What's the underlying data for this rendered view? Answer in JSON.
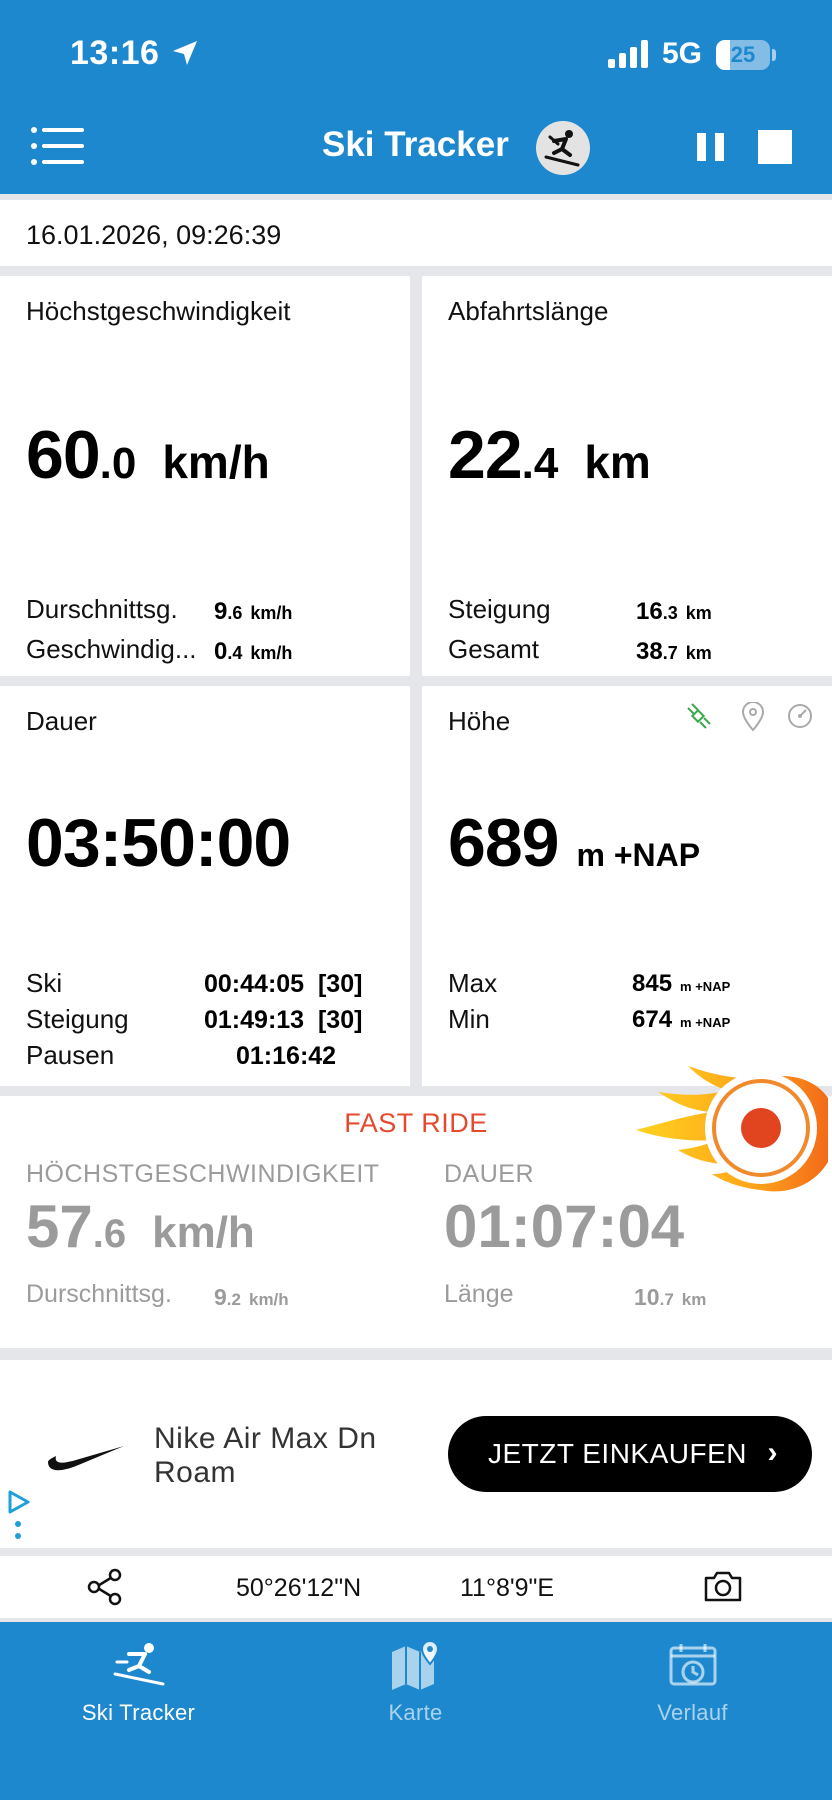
{
  "status": {
    "time": "13:16",
    "network": "5G",
    "battery": "25",
    "battery_level": 0.25
  },
  "header": {
    "title": "Ski Tracker",
    "icons": [
      "menu-icon",
      "skier-icon",
      "pause-icon",
      "stop-icon"
    ]
  },
  "session": {
    "datetime": "16.01.2026, 09:26:39"
  },
  "speed_card": {
    "label": "Höchstgeschwindigkeit",
    "value_int": "60",
    "value_dec": ".0",
    "unit": "km/h",
    "rows": [
      {
        "label": "Durschnittsg.",
        "int": "9",
        "dec": ".6",
        "unit": "km/h"
      },
      {
        "label": "Geschwindig...",
        "int": "0",
        "dec": ".4",
        "unit": "km/h"
      }
    ]
  },
  "distance_card": {
    "label": "Abfahrtslänge",
    "value_int": "22",
    "value_dec": ".4",
    "unit": "km",
    "rows": [
      {
        "label": "Steigung",
        "int": "16",
        "dec": ".3",
        "unit": "km"
      },
      {
        "label": "Gesamt",
        "int": "38",
        "dec": ".7",
        "unit": "km"
      }
    ]
  },
  "duration_card": {
    "label": "Dauer",
    "value": "03:50:00",
    "rows": [
      {
        "label": "Ski",
        "value": "00:44:05",
        "count": "[30]"
      },
      {
        "label": "Steigung",
        "value": "01:49:13",
        "count": "[30]"
      },
      {
        "label": "Pausen",
        "value": "01:16:42"
      }
    ]
  },
  "altitude_card": {
    "label": "Höhe",
    "value": "689",
    "unit": "m +NAP",
    "icons": [
      "satellite-icon",
      "location-pin-icon",
      "gauge-icon"
    ],
    "rows": [
      {
        "label": "Max",
        "value": "845",
        "unit": "m +NAP"
      },
      {
        "label": "Min",
        "value": "674",
        "unit": "m +NAP"
      }
    ]
  },
  "fast_ride": {
    "title": "FAST RIDE",
    "speed_label": "HÖCHSTGESCHWINDIGKEIT",
    "speed_int": "57",
    "speed_dec": ".6",
    "speed_unit": "km/h",
    "avg_label": "Durschnittsg.",
    "avg_int": "9",
    "avg_dec": ".2",
    "avg_unit": "km/h",
    "duration_label": "DAUER",
    "duration_value": "01:07:04",
    "length_label": "Länge",
    "length_int": "10",
    "length_dec": ".7",
    "length_unit": "km",
    "colors": {
      "title": "#e64a2e",
      "record": "#e0451f"
    }
  },
  "ad": {
    "product": "Nike Air Max Dn Roam",
    "cta": "JETZT EINKAUFEN",
    "icons": [
      "nike-swoosh-icon",
      "adchoices-icon"
    ]
  },
  "location": {
    "latitude": "50°26'12\"N",
    "longitude": "11°8'9\"E",
    "icons": [
      "share-icon",
      "camera-icon"
    ]
  },
  "tabs": [
    {
      "label": "Ski Tracker",
      "icon": "skier-icon",
      "active": true
    },
    {
      "label": "Karte",
      "icon": "map-icon",
      "active": false
    },
    {
      "label": "Verlauf",
      "icon": "history-calendar-icon",
      "active": false
    }
  ],
  "colors": {
    "brand": "#1e88cf",
    "background": "#e4e6ea",
    "muted_text": "#9b9b9b"
  }
}
